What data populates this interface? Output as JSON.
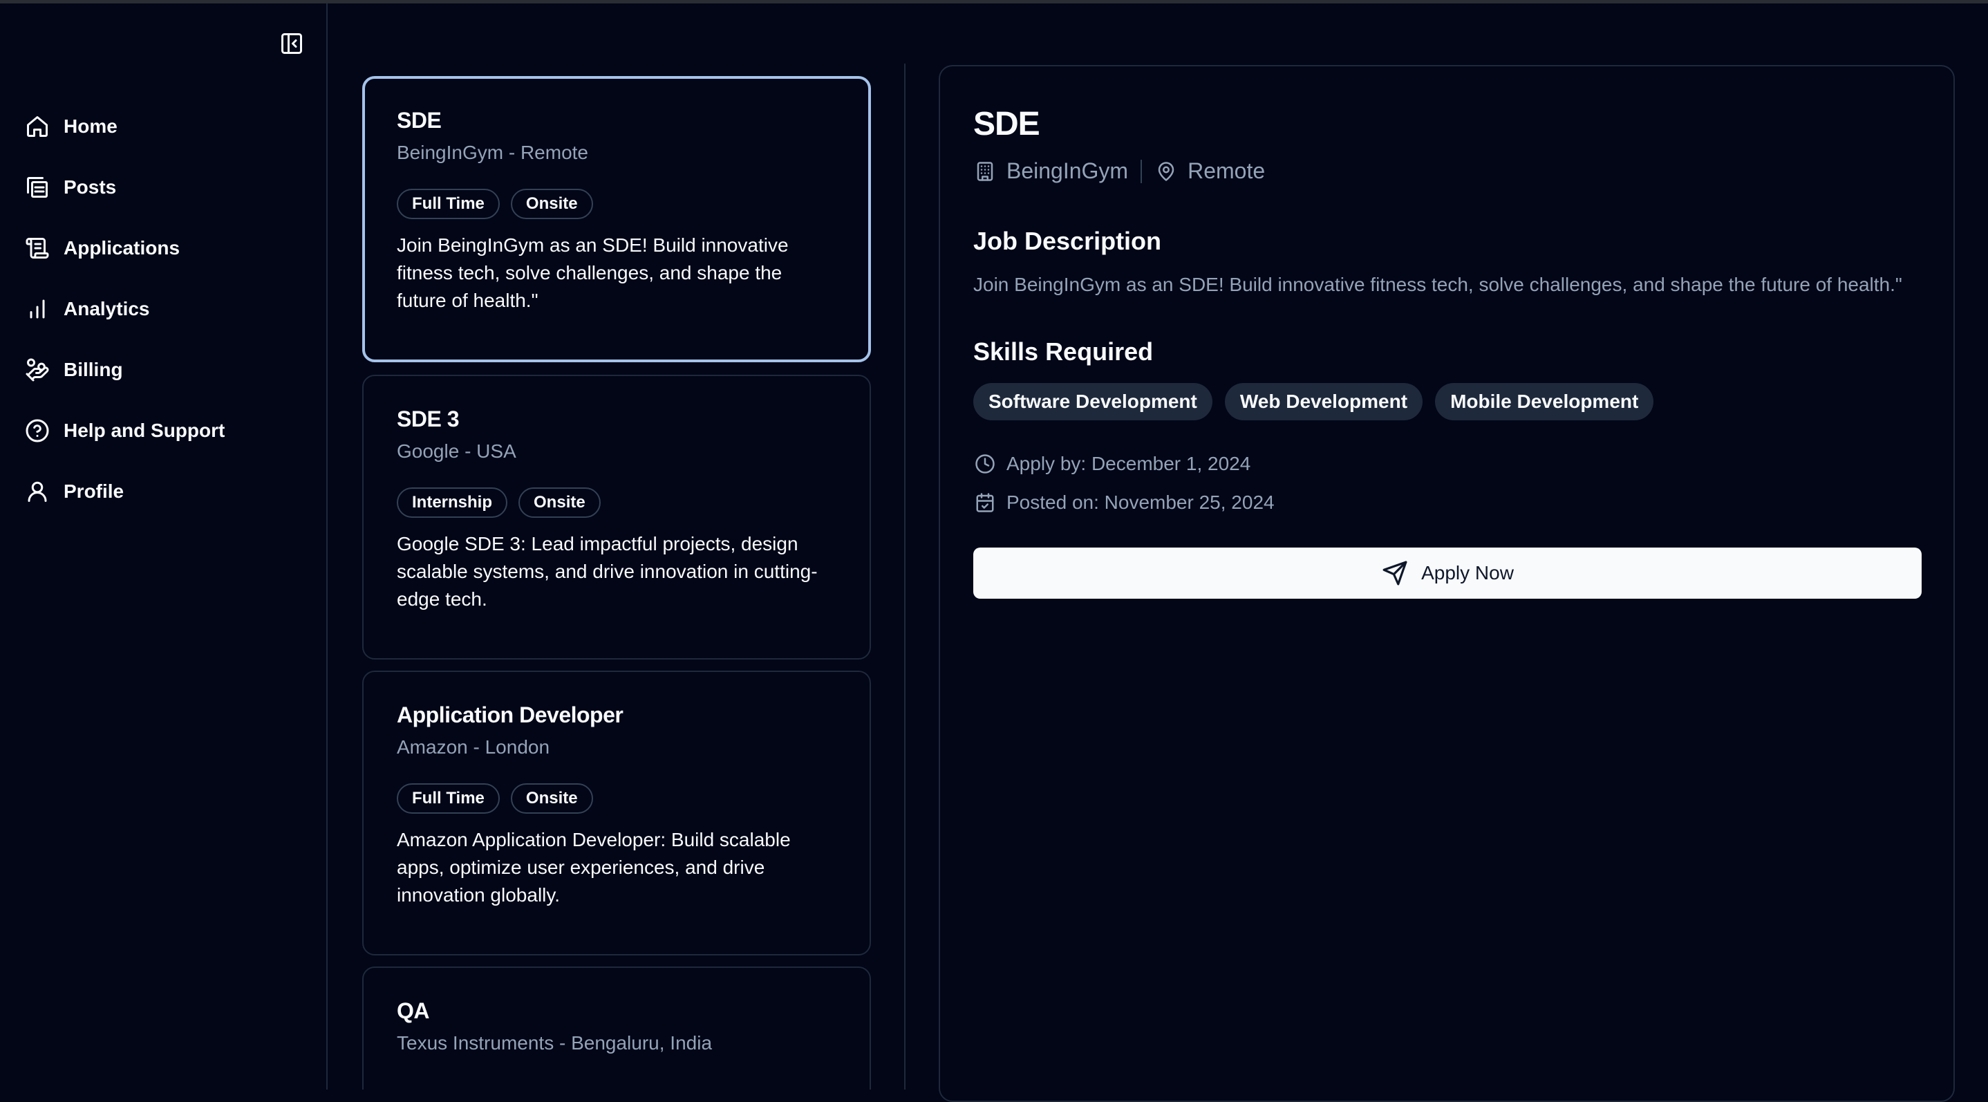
{
  "sidebar": {
    "items": [
      {
        "label": "Home",
        "icon": "home-icon"
      },
      {
        "label": "Posts",
        "icon": "posts-icon"
      },
      {
        "label": "Applications",
        "icon": "applications-icon"
      },
      {
        "label": "Analytics",
        "icon": "analytics-icon"
      },
      {
        "label": "Billing",
        "icon": "billing-icon"
      },
      {
        "label": "Help and Support",
        "icon": "help-icon"
      },
      {
        "label": "Profile",
        "icon": "profile-icon"
      }
    ]
  },
  "jobs": [
    {
      "title": "SDE",
      "subtitle": "BeingInGym - Remote",
      "tags": [
        "Full Time",
        "Onsite"
      ],
      "description": "Join BeingInGym as an SDE! Build innovative fitness tech, solve challenges, and shape the future of health.\""
    },
    {
      "title": "SDE 3",
      "subtitle": "Google - USA",
      "tags": [
        "Internship",
        "Onsite"
      ],
      "description": "Google SDE 3: Lead impactful projects, design scalable systems, and drive innovation in cutting-edge tech."
    },
    {
      "title": "Application Developer",
      "subtitle": "Amazon - London",
      "tags": [
        "Full Time",
        "Onsite"
      ],
      "description": "Amazon Application Developer: Build scalable apps, optimize user experiences, and drive innovation globally."
    },
    {
      "title": "QA",
      "subtitle": "Texus Instruments - Bengaluru, India",
      "tags": [],
      "description": ""
    }
  ],
  "detail": {
    "title": "SDE",
    "company": "BeingInGym",
    "location": "Remote",
    "description_heading": "Job Description",
    "description": "Join BeingInGym as an SDE! Build innovative fitness tech, solve challenges, and shape the future of health.\"",
    "skills_heading": "Skills Required",
    "skills": [
      "Software Development",
      "Web Development",
      "Mobile Development"
    ],
    "apply_by": "Apply by: December 1, 2024",
    "posted_on": "Posted on: November 25, 2024",
    "apply_label": "Apply Now"
  },
  "colors": {
    "background": "#020617",
    "selected_border": "#a5c3ea",
    "muted_text": "#94a3b8",
    "button_bg": "#f8fafc"
  }
}
